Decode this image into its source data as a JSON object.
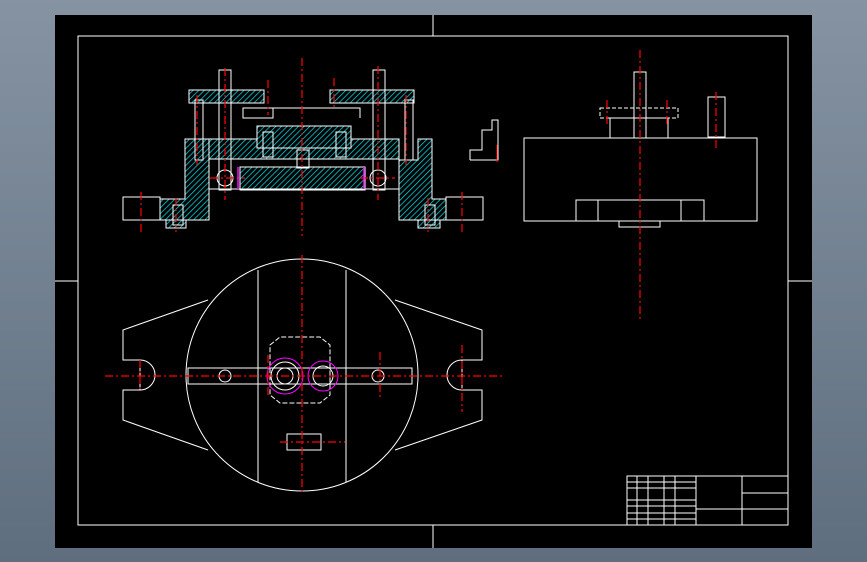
{
  "viewer": {
    "background": "#000000",
    "frame_color": "#ffffff",
    "hatch_color": "#00ffff",
    "centerline_color": "#ff0000",
    "accent_color": "#ff00ff"
  },
  "drawing": {
    "views": [
      "front-section-view",
      "side-view",
      "top-view"
    ],
    "title_block": "title-block"
  }
}
